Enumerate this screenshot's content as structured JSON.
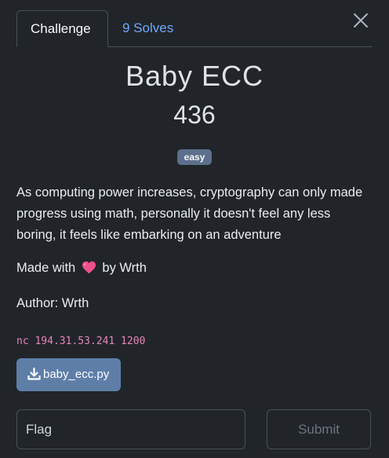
{
  "tabs": {
    "challenge": "Challenge",
    "solves": "9 Solves"
  },
  "challenge": {
    "name": "Baby ECC",
    "points": "436",
    "difficulty": "easy",
    "description": "As computing power increases, cryptography can only made progress using math, personally it doesn't feel any less boring, it feels like embarking on an adventure",
    "made_with_prefix": "Made with",
    "made_with_suffix": "by Wrth",
    "author": "Author: Wrth",
    "connection": "nc 194.31.53.241 1200",
    "file": "baby_ecc.py"
  },
  "form": {
    "flag_placeholder": "Flag",
    "submit_label": "Submit"
  },
  "icons": {
    "close": "close-icon",
    "heart": "heart-icon",
    "download": "download-icon"
  },
  "colors": {
    "background": "#212529",
    "link": "#6ea8fe",
    "badge": "#5c6f8c",
    "download_button": "#5e7ea8",
    "code": "#e685b5",
    "heart": "#f0508a"
  }
}
